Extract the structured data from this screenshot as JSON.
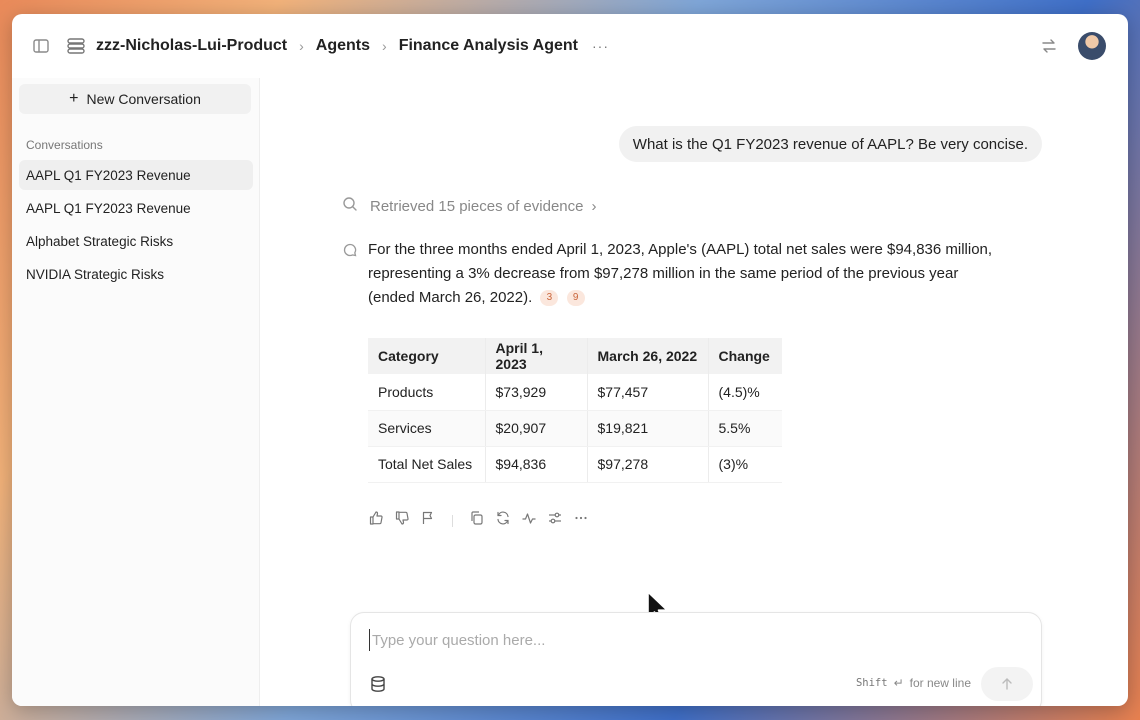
{
  "breadcrumb": {
    "workspace": "zzz-Nicholas-Lui-Product",
    "section": "Agents",
    "page": "Finance Analysis Agent",
    "more": "···"
  },
  "sidebar": {
    "new_conversation_label": "New Conversation",
    "section_label": "Conversations",
    "items": [
      {
        "label": "AAPL Q1 FY2023 Revenue",
        "active": true
      },
      {
        "label": "AAPL Q1 FY2023 Revenue",
        "active": false
      },
      {
        "label": "Alphabet Strategic Risks",
        "active": false
      },
      {
        "label": "NVIDIA Strategic Risks",
        "active": false
      }
    ]
  },
  "chat": {
    "user_message": "What is the Q1 FY2023 revenue of AAPL? Be very concise.",
    "evidence_label": "Retrieved 15 pieces of evidence",
    "answer_text": "For the three months ended April 1, 2023, Apple's (AAPL) total net sales were $94,836 million, representing a 3% decrease from $97,278 million in the same period of the previous year (ended March 26, 2022).",
    "citations": [
      "3",
      "9"
    ],
    "table": {
      "headers": [
        "Category",
        "April 1, 2023",
        "March 26, 2022",
        "Change"
      ],
      "rows": [
        [
          "Products",
          "$73,929",
          "$77,457",
          "(4.5)%"
        ],
        [
          "Services",
          "$20,907",
          "$19,821",
          "5.5%"
        ],
        [
          "Total Net Sales",
          "$94,836",
          "$97,278",
          "(3)%"
        ]
      ]
    },
    "action_icons": [
      "thumbs-up-icon",
      "thumbs-down-icon",
      "flag-icon",
      "copy-icon",
      "regenerate-icon",
      "activity-icon",
      "settings-sliders-icon",
      "more-icon"
    ]
  },
  "composer": {
    "placeholder": "Type your question here...",
    "hint_key": "Shift",
    "hint_text": "for new line",
    "enter_symbol": "↵"
  },
  "colors": {
    "citation_bg": "#fbe7dd",
    "citation_fg": "#c9653a",
    "sidebar_active": "#efefef"
  }
}
